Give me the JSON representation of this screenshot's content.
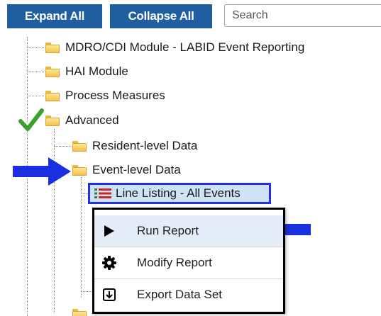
{
  "toolbar": {
    "expand_all": "Expand All",
    "collapse_all": "Collapse All",
    "search_placeholder": "Search"
  },
  "tree": {
    "mdro": "MDRO/CDI Module - LABID Event Reporting",
    "hai": "HAI Module",
    "process": "Process Measures",
    "advanced": "Advanced",
    "resident": "Resident-level Data",
    "event": "Event-level Data",
    "selected_report": "Line Listing - All Events"
  },
  "context_menu": {
    "run": "Run Report",
    "modify": "Modify Report",
    "export": "Export Data Set"
  },
  "colors": {
    "button_blue": "#1f5fa0",
    "highlight_border": "#2233dd",
    "annotation_arrow": "#1a2fe0",
    "check_green": "#3aa12f"
  }
}
